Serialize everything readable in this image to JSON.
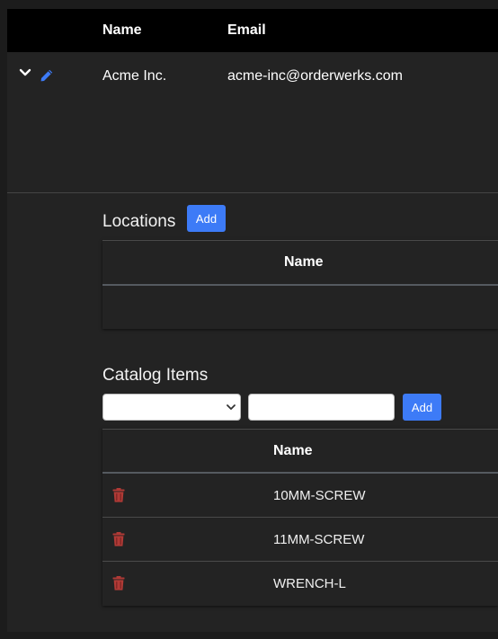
{
  "header": {
    "col_name": "Name",
    "col_email": "Email"
  },
  "customer": {
    "name": "Acme Inc.",
    "email": "acme-inc@orderwerks.com"
  },
  "locations": {
    "title": "Locations",
    "add_label": "Add",
    "columns": [
      "Name"
    ],
    "rows": []
  },
  "catalog": {
    "title": "Catalog Items",
    "select_value": "",
    "input_value": "",
    "add_label": "Add",
    "columns": [
      "Name"
    ],
    "items": [
      {
        "name": "10MM-SCREW"
      },
      {
        "name": "11MM-SCREW"
      },
      {
        "name": "WRENCH-L"
      }
    ]
  },
  "icons": {
    "expand": "chevron-down-icon",
    "edit": "pencil-icon",
    "delete": "trash-icon"
  },
  "colors": {
    "accent": "#3d7bf7",
    "delete": "#b03a36",
    "header_bg": "#000000",
    "panel_bg": "#232323"
  }
}
